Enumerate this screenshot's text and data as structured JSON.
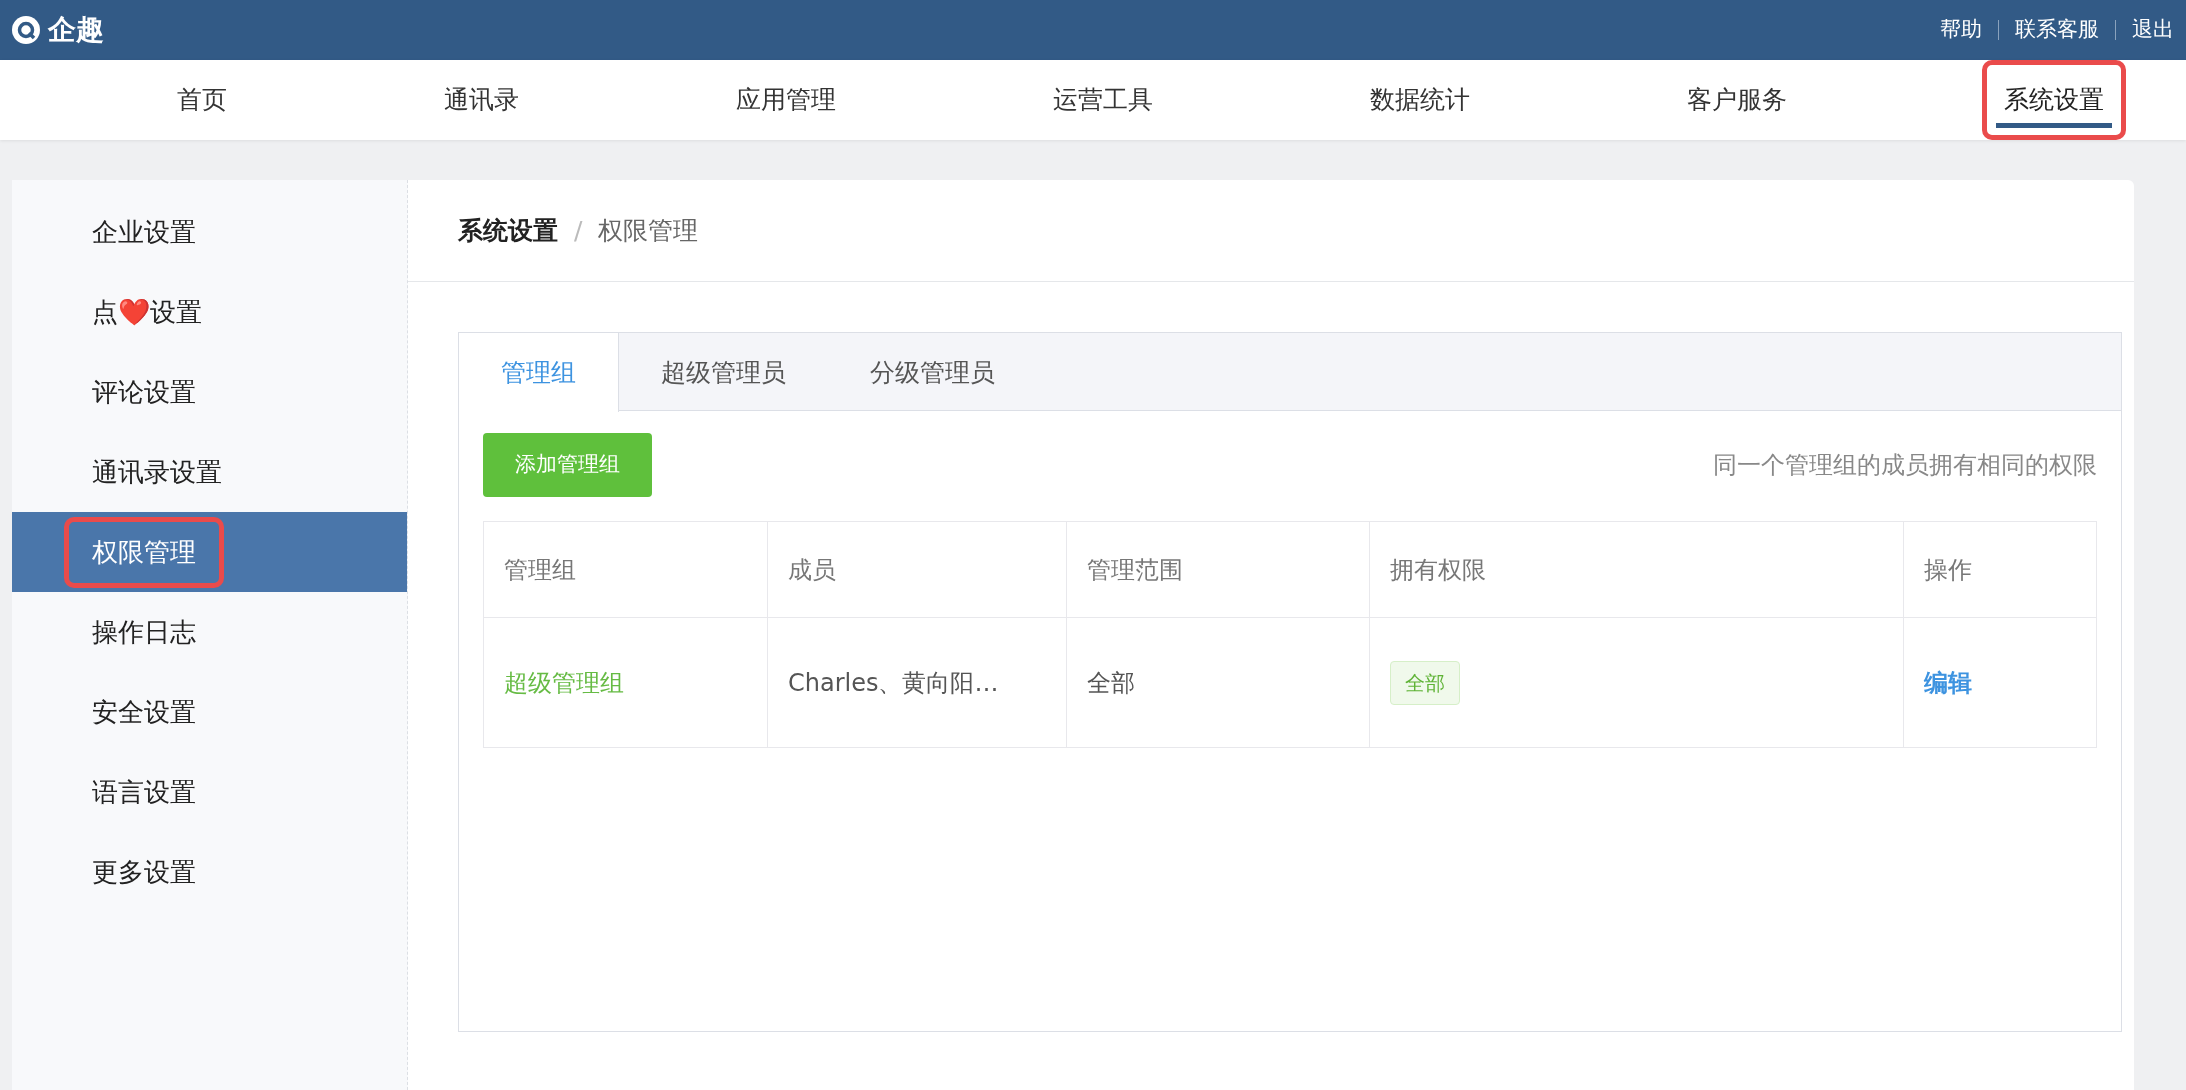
{
  "brand": {
    "name": "企趣"
  },
  "top_links": [
    "帮助",
    "联系客服",
    "退出"
  ],
  "nav": [
    {
      "label": "首页",
      "selected": false,
      "highlighted": false
    },
    {
      "label": "通讯录",
      "selected": false,
      "highlighted": false
    },
    {
      "label": "应用管理",
      "selected": false,
      "highlighted": false
    },
    {
      "label": "运营工具",
      "selected": false,
      "highlighted": false
    },
    {
      "label": "数据统计",
      "selected": false,
      "highlighted": false
    },
    {
      "label": "客户服务",
      "selected": false,
      "highlighted": false
    },
    {
      "label": "系统设置",
      "selected": true,
      "highlighted": true
    }
  ],
  "sidebar": {
    "items": [
      {
        "label": "企业设置",
        "selected": false,
        "highlighted": false
      },
      {
        "label": "点❤️设置",
        "selected": false,
        "highlighted": false
      },
      {
        "label": "评论设置",
        "selected": false,
        "highlighted": false
      },
      {
        "label": "通讯录设置",
        "selected": false,
        "highlighted": false
      },
      {
        "label": "权限管理",
        "selected": true,
        "highlighted": true
      },
      {
        "label": "操作日志",
        "selected": false,
        "highlighted": false
      },
      {
        "label": "安全设置",
        "selected": false,
        "highlighted": false
      },
      {
        "label": "语言设置",
        "selected": false,
        "highlighted": false
      },
      {
        "label": "更多设置",
        "selected": false,
        "highlighted": false
      }
    ]
  },
  "breadcrumb": [
    "系统设置",
    "/",
    "权限管理"
  ],
  "tabs": [
    {
      "label": "管理组",
      "selected": true
    },
    {
      "label": "超级管理员",
      "selected": false
    },
    {
      "label": "分级管理员",
      "selected": false
    }
  ],
  "add_button": "添加管理组",
  "hint": "同一个管理组的成员拥有相同的权限",
  "table": {
    "columns": [
      "管理组",
      "成员",
      "管理范围",
      "拥有权限",
      "操作"
    ],
    "rows": [
      {
        "group": "超级管理组",
        "members": "Charles、黄向阳…",
        "scope": "全部",
        "permission": "全部",
        "action": "编辑"
      }
    ]
  }
}
